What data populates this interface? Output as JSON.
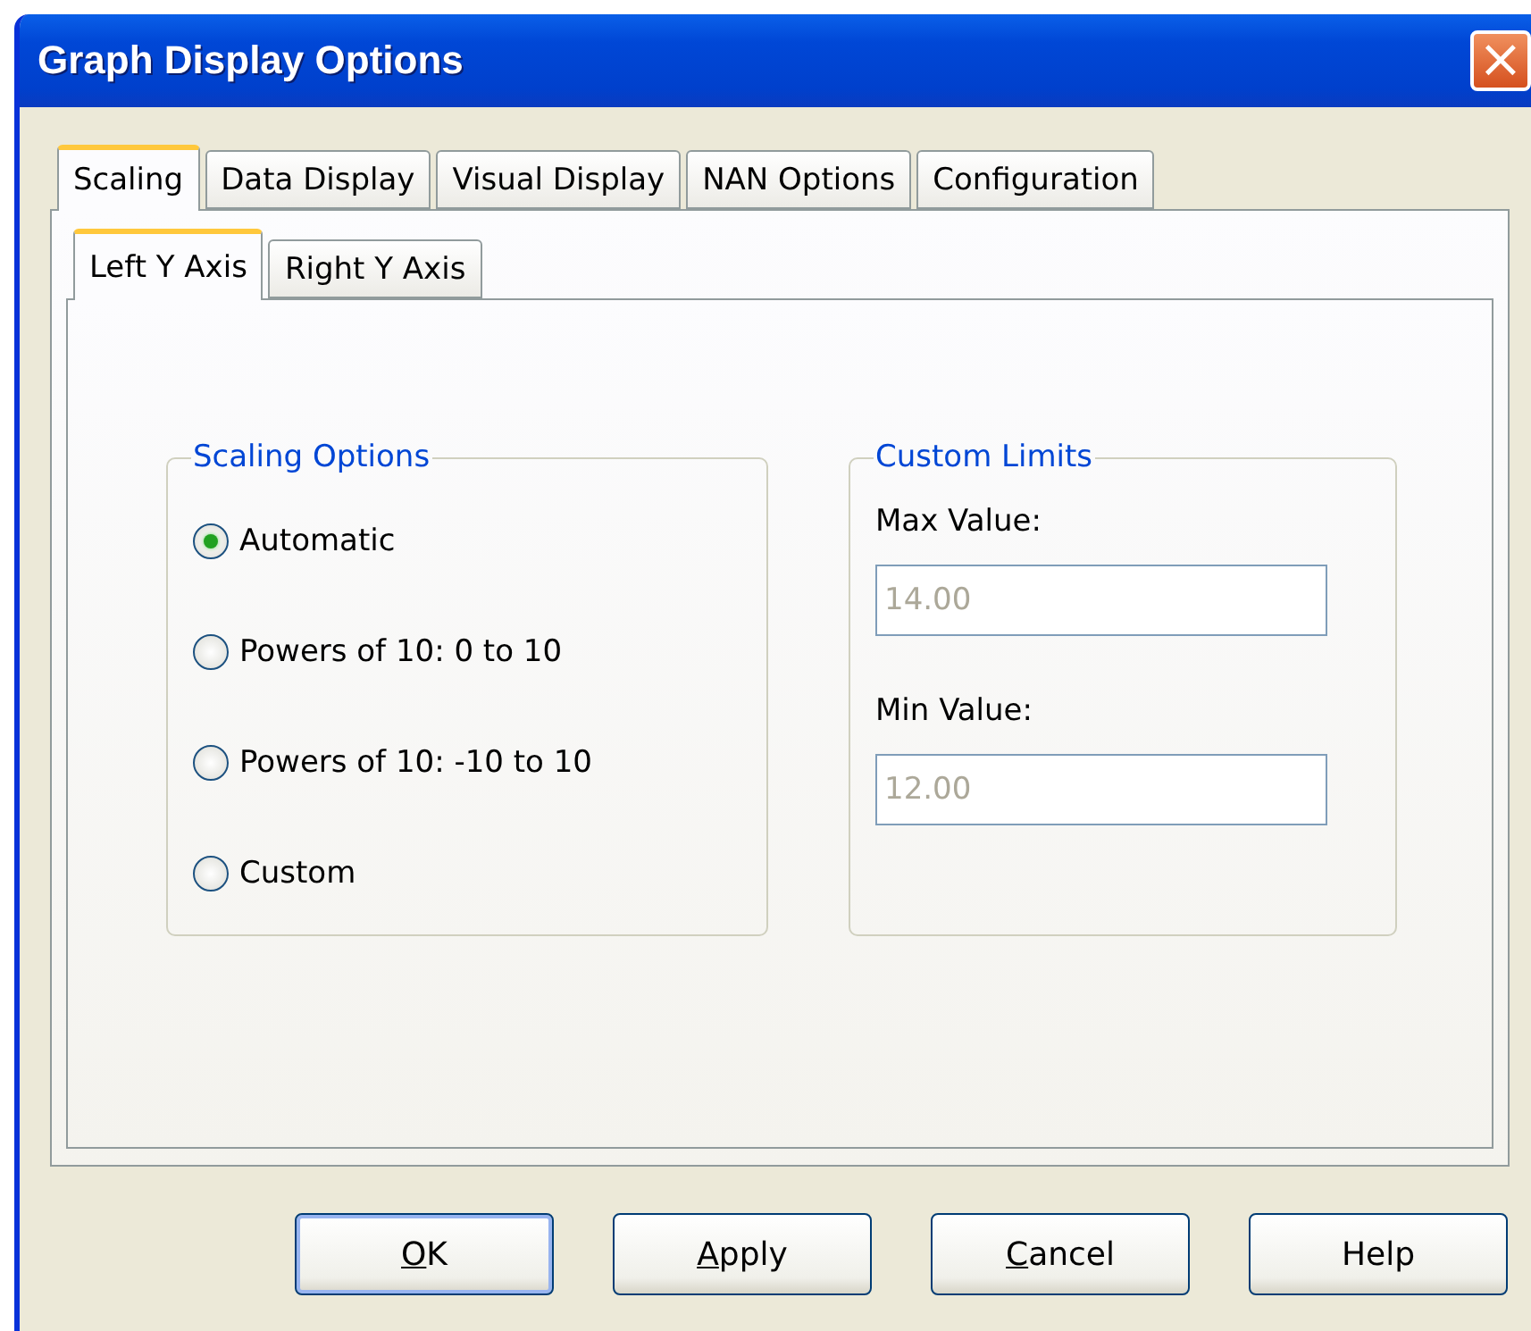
{
  "window": {
    "title": "Graph Display Options",
    "close": "×"
  },
  "tabs": [
    {
      "label": "Scaling",
      "selected": true
    },
    {
      "label": "Data Display",
      "selected": false
    },
    {
      "label": "Visual Display",
      "selected": false
    },
    {
      "label": "NAN Options",
      "selected": false
    },
    {
      "label": "Configuration",
      "selected": false
    }
  ],
  "subtabs": [
    {
      "label": "Left Y Axis",
      "selected": true
    },
    {
      "label": "Right Y Axis",
      "selected": false
    }
  ],
  "scaling_options": {
    "title": "Scaling Options",
    "options": [
      {
        "label": "Automatic",
        "selected": true
      },
      {
        "label": "Powers of 10: 0 to 10",
        "selected": false
      },
      {
        "label": "Powers of 10: -10 to 10",
        "selected": false
      },
      {
        "label": "Custom",
        "selected": false
      }
    ]
  },
  "custom_limits": {
    "title": "Custom Limits",
    "fields": [
      {
        "label": "Max Value:",
        "value": "14.00",
        "disabled": true
      },
      {
        "label": "Min Value:",
        "value": "12.00",
        "disabled": true
      }
    ]
  },
  "buttons": [
    {
      "label": "OK",
      "first_letter_underlined": true,
      "default": true
    },
    {
      "label": "Apply",
      "first_letter_underlined": true,
      "default": false
    },
    {
      "label": "Cancel",
      "first_letter_underlined": true,
      "default": false
    },
    {
      "label": "Help",
      "first_letter_underlined": false,
      "default": false
    }
  ]
}
